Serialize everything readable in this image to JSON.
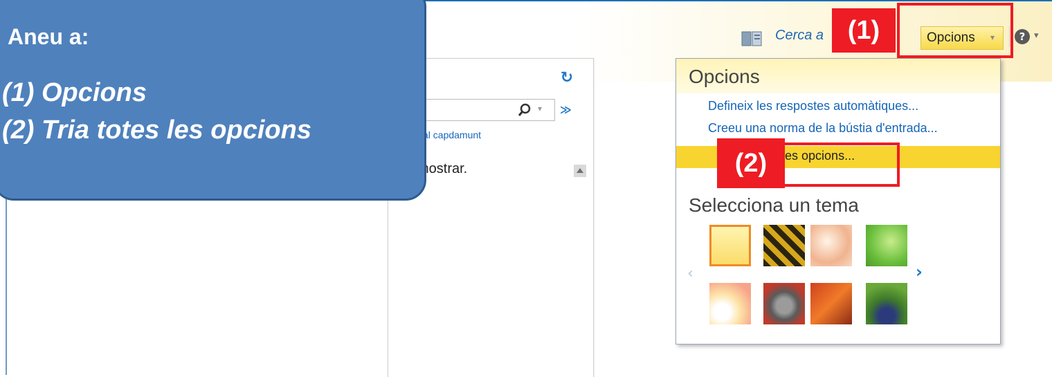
{
  "overlay": {
    "title": "Aneu a:",
    "step1": "(1) Opcions",
    "step2": "(2) Tria totes les opcions"
  },
  "header": {
    "search_link": "Cerca a",
    "options_button": "Opcions",
    "help_icon": "help-icon"
  },
  "pane": {
    "scroll_top_link": "al capdamunt",
    "empty_message": "mostrar."
  },
  "options_menu": {
    "title": "Opcions",
    "items": [
      "Defineix les respostes automàtiques...",
      "Creeu una norma de la bústia d'entrada..."
    ],
    "highlighted_item": "tes les opcions...",
    "theme_title": "Selecciona un tema"
  },
  "callouts": {
    "label1": "(1)",
    "label2": "(2)"
  },
  "colors": {
    "callout_red": "#ee1c24",
    "overlay_blue": "#4f81bd",
    "menu_highlight": "#f8d431",
    "link_blue": "#1565b8"
  }
}
